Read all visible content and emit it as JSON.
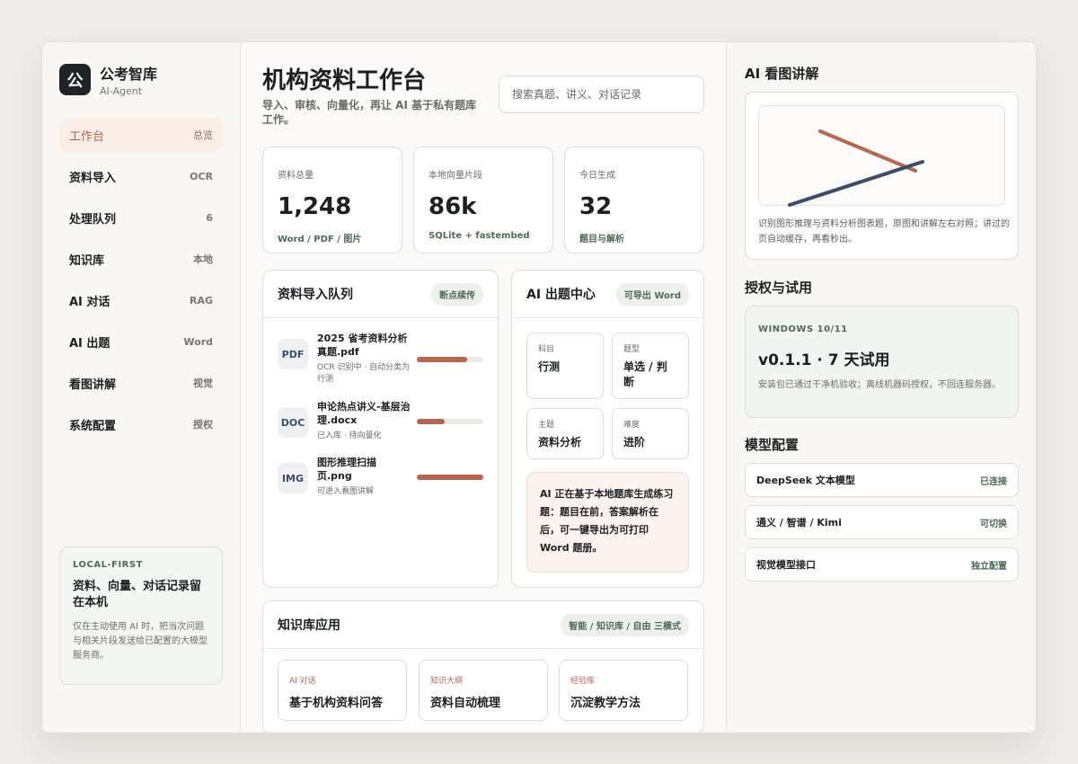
{
  "brand": {
    "name": "公考智库",
    "sub": "AI-Agent",
    "logo": "公"
  },
  "nav": [
    {
      "label": "工作台",
      "tag": "总览",
      "active": true
    },
    {
      "label": "资料导入",
      "tag": "OCR"
    },
    {
      "label": "处理队列",
      "tag": "6"
    },
    {
      "label": "知识库",
      "tag": "本地"
    },
    {
      "label": "AI 对话",
      "tag": "RAG"
    },
    {
      "label": "AI 出题",
      "tag": "Word"
    },
    {
      "label": "看图讲解",
      "tag": "视觉"
    },
    {
      "label": "系统配置",
      "tag": "授权"
    }
  ],
  "local": {
    "eyebrow": "LOCAL-FIRST",
    "title": "资料、向量、对话记录留在本机",
    "desc": "仅在主动使用 AI 时，把当次问题与相关片段发送给已配置的大模型服务商。"
  },
  "header": {
    "title": "机构资料工作台",
    "subtitle": "导入、审核、向量化，再让 AI 基于私有题库工作。",
    "search_placeholder": "搜索真题、讲义、对话记录"
  },
  "stats": [
    {
      "label": "资料总量",
      "value": "1,248",
      "sub": "Word / PDF / 图片"
    },
    {
      "label": "本地向量片段",
      "value": "86k",
      "sub": "SQLite + fastembed"
    },
    {
      "label": "今日生成",
      "value": "32",
      "sub": "题目与解析"
    }
  ],
  "queue": {
    "title": "资料导入队列",
    "badge": "断点续传",
    "items": [
      {
        "type": "PDF",
        "name": "2025 省考资料分析真题.pdf",
        "status": "OCR 识别中 · 自动分类为行测",
        "progress": 0.75
      },
      {
        "type": "DOC",
        "name": "申论热点讲义-基层治理.docx",
        "status": "已入库 · 待向量化",
        "progress": 0.42
      },
      {
        "type": "IMG",
        "name": "图形推理扫描页.png",
        "status": "可进入看图讲解",
        "progress": 1.0
      }
    ]
  },
  "gen": {
    "title": "AI 出题中心",
    "badge": "可导出 Word",
    "fields": [
      {
        "label": "科目",
        "value": "行测"
      },
      {
        "label": "题型",
        "value": "单选 / 判断"
      },
      {
        "label": "主题",
        "value": "资料分析"
      },
      {
        "label": "难度",
        "value": "进阶"
      }
    ],
    "note": "AI 正在基于本地题库生成练习题：题目在前，答案解析在后，可一键导出为可打印 Word 题册。"
  },
  "kb": {
    "title": "知识库应用",
    "badge": "智能 / 知识库 / 自由 三模式",
    "cards": [
      {
        "tag": "AI 对话",
        "value": "基于机构资料问答"
      },
      {
        "tag": "知识大纲",
        "value": "资料自动梳理"
      },
      {
        "tag": "经验库",
        "value": "沉淀教学方法"
      }
    ]
  },
  "vision": {
    "title": "AI 看图讲解",
    "desc": "识别图形推理与资料分析图表题，原图和讲解左右对照；讲过的页自动缓存，再看秒出。"
  },
  "license": {
    "title": "授权与试用",
    "eyebrow": "WINDOWS 10/11",
    "version": "v0.1.1 · 7 天试用",
    "desc": "安装包已通过干净机验收；离线机器码授权，不回连服务器。"
  },
  "models": {
    "title": "模型配置",
    "items": [
      {
        "name": "DeepSeek 文本模型",
        "status": "已连接"
      },
      {
        "name": "通义 / 智谱 / Kimi",
        "status": "可切换"
      },
      {
        "name": "视觉模型接口",
        "status": "独立配置"
      }
    ]
  },
  "colors": {
    "accent": "#b9654f",
    "green": "#4e6b55",
    "navy": "#3b4d6b",
    "dark": "#1f2226"
  }
}
